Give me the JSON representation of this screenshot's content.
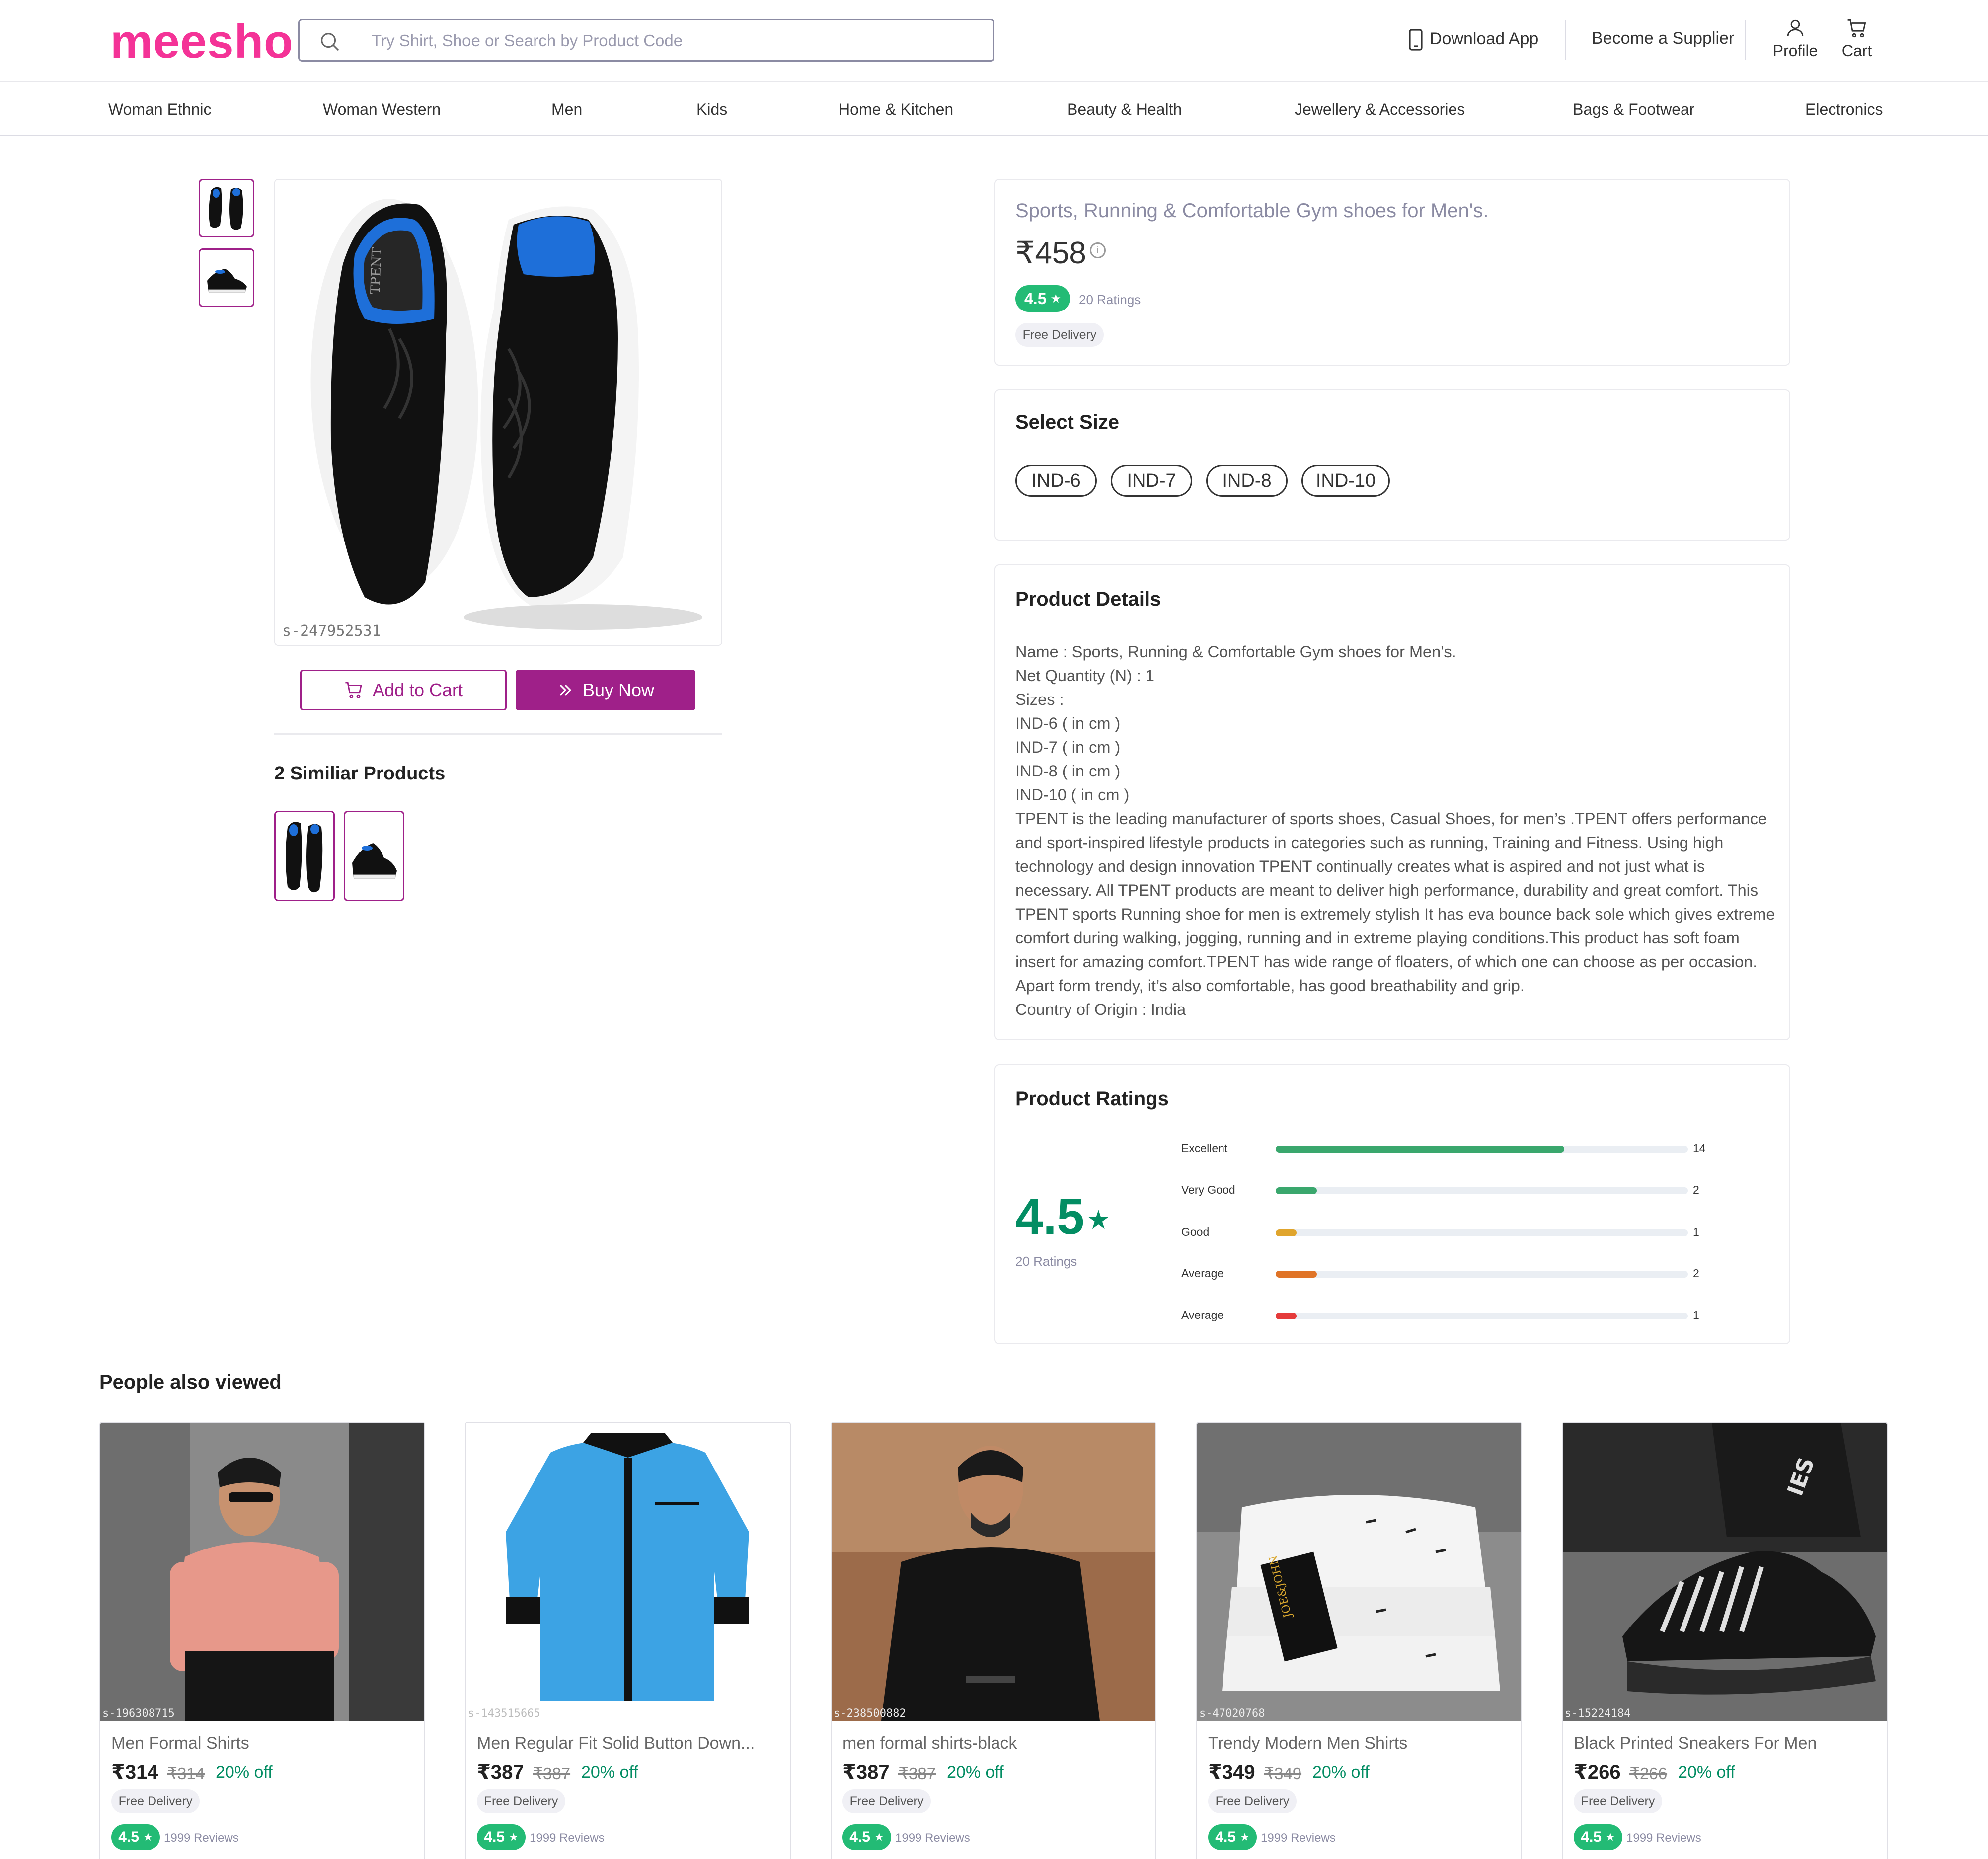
{
  "header": {
    "logo": "meesho",
    "search_placeholder": "Try Shirt, Shoe or Search by Product Code",
    "download_app": "Download App",
    "become_supplier": "Become a Supplier",
    "profile": "Profile",
    "cart": "Cart"
  },
  "categories": [
    "Woman Ethnic",
    "Woman Western",
    "Men",
    "Kids",
    "Home & Kitchen",
    "Beauty & Health",
    "Jewellery & Accessories",
    "Bags & Footwear",
    "Electronics"
  ],
  "product": {
    "catalog_code": "s-247952531",
    "add_to_cart": "Add to Cart",
    "buy_now": "Buy Now",
    "similar_title": "2 Similiar Products",
    "title": "Sports, Running & Comfortable Gym shoes for Men's.",
    "price": "₹458",
    "rating": "4.5",
    "ratings_count": "20 Ratings",
    "free_delivery": "Free Delivery"
  },
  "sizes": {
    "title": "Select Size",
    "options": [
      "IND-6",
      "IND-7",
      "IND-8",
      "IND-10"
    ]
  },
  "details": {
    "title": "Product Details",
    "lines": [
      "Name : Sports, Running & Comfortable Gym shoes for Men's.",
      "Net Quantity (N) : 1",
      "Sizes :",
      "IND-6 ( in cm )",
      "IND-7 ( in cm )",
      "IND-8 ( in cm )",
      "IND-10 ( in cm )",
      "TPENT is the leading manufacturer of sports shoes, Casual Shoes, for men’s .TPENT offers performance and sport-inspired lifestyle products in categories such as running, Training and Fitness. Using high technology and design innovation TPENT continually creates what is aspired and not just what is necessary. All TPENT products are meant to deliver high performance, durability and great comfort. This TPENT sports Running shoe for men is extremely stylish It has eva bounce back sole which gives extreme comfort during walking, jogging, running and in extreme playing conditions.This product has soft foam insert for amazing comfort.TPENT has wide range of floaters, of which one can choose as per occasion. Apart form trendy, it’s also comfortable, has good breathability and grip.",
      "Country of Origin : India"
    ]
  },
  "ratings": {
    "title": "Product Ratings",
    "average": "4.5",
    "count": "20 Ratings",
    "max_count": 20,
    "rows": [
      {
        "label": "Excellent",
        "count": 14,
        "color": "#3aa76d"
      },
      {
        "label": "Very Good",
        "count": 2,
        "color": "#3aa76d"
      },
      {
        "label": "Good",
        "count": 1,
        "color": "#e0a52d"
      },
      {
        "label": "Average",
        "count": 2,
        "color": "#e07427"
      },
      {
        "label": "Average",
        "count": 1,
        "color": "#e53b3b"
      }
    ]
  },
  "people_also_viewed": {
    "title": "People also viewed",
    "items": [
      {
        "code": "s-196308715",
        "name": "Men Formal Shirts",
        "price": "₹314",
        "mrp": "₹314",
        "off": "20% off",
        "delivery": "Free Delivery",
        "rating": "4.5",
        "reviews": "1999 Reviews"
      },
      {
        "code": "s-143515665",
        "name": "Men Regular Fit Solid Button Down...",
        "price": "₹387",
        "mrp": "₹387",
        "off": "20% off",
        "delivery": "Free Delivery",
        "rating": "4.5",
        "reviews": "1999 Reviews"
      },
      {
        "code": "s-238500882",
        "name": "men formal shirts-black",
        "price": "₹387",
        "mrp": "₹387",
        "off": "20% off",
        "delivery": "Free Delivery",
        "rating": "4.5",
        "reviews": "1999 Reviews"
      },
      {
        "code": "s-47020768",
        "name": "Trendy Modern Men Shirts",
        "price": "₹349",
        "mrp": "₹349",
        "off": "20% off",
        "delivery": "Free Delivery",
        "rating": "4.5",
        "reviews": "1999 Reviews"
      },
      {
        "code": "s-15224184",
        "name": "Black Printed Sneakers For Men",
        "price": "₹266",
        "mrp": "₹266",
        "off": "20% off",
        "delivery": "Free Delivery",
        "rating": "4.5",
        "reviews": "1999 Reviews"
      }
    ]
  },
  "colors": {
    "brand_pink": "#f43397",
    "brand_purple": "#9f2089",
    "rating_green": "#23bb75"
  }
}
